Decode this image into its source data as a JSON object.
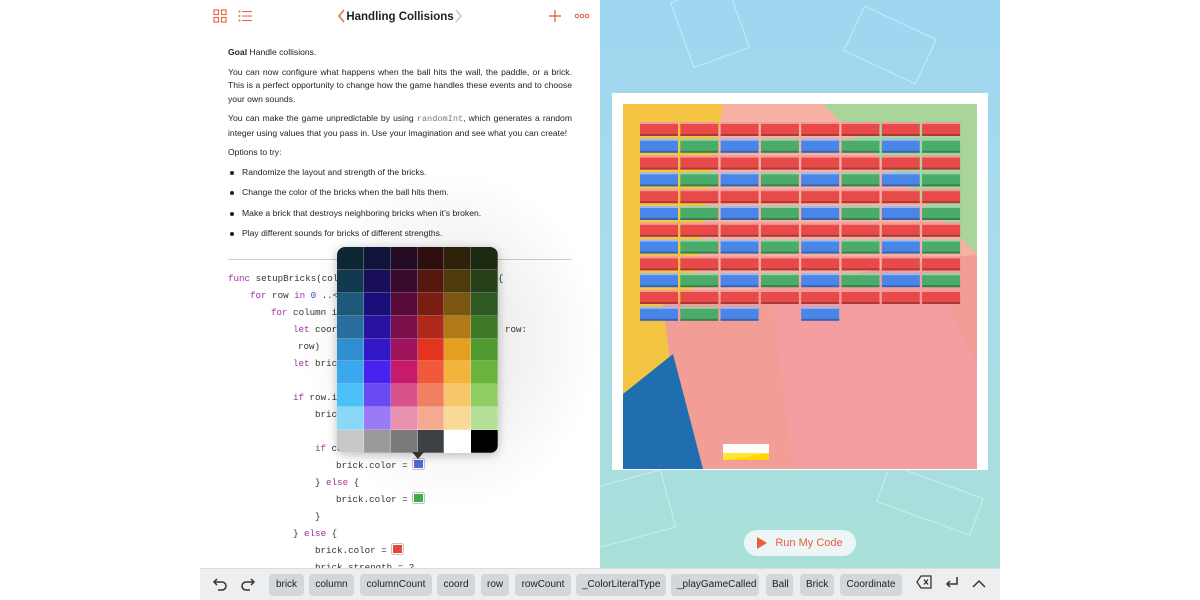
{
  "header": {
    "title": "Handling Collisions",
    "grid_icon": "grid-icon",
    "list_icon": "list-icon",
    "back_icon": "chevron-left-icon",
    "forward_icon": "chevron-right-icon",
    "add_icon": "plus-icon",
    "more_icon": "more-icon"
  },
  "prose": {
    "goal_label": "Goal",
    "goal_text": " Handle collisions.",
    "p1": "You can now configure what happens when the ball hits the wall, the paddle, or a brick. This is a perfect opportunity to change how the game handles these events and to choose your own sounds.",
    "p2_a": "You can make the game unpredictable by using ",
    "p2_code": "randomInt",
    "p2_b": ", which generates a random integer using values that you pass in. Use your imagination and see what you can create!",
    "options_label": "Options to try:",
    "options": [
      "Randomize the layout and strength of the bricks.",
      "Change the color of the bricks when the ball hits them.",
      "Make a brick that destroys neighboring bricks when it’s broken.",
      "Play different sounds for bricks of different strengths."
    ]
  },
  "code": {
    "l1_kw": "func",
    "l1": " setupBricks(col",
    "l1_tail": "{",
    "l2_kw": "for",
    "l2_a": " row ",
    "l2_kw2": "in",
    "l2_num": " 0",
    "l2_b": " ..<",
    "l3_kw": "for",
    "l3_a": " column i",
    "l4_kw": "let",
    "l4_a": " coor",
    "l4_tail": "row:",
    "l5": "row)",
    "l6_kw": "let",
    "l6_a": " bric",
    "l7_kw": "if",
    "l7_a": " row.i",
    "l8": "bric",
    "l9_kw": "if",
    "l9_a": " co",
    "l10": "brick.color = ",
    "l11_a": "} ",
    "l11_kw": "else",
    "l11_b": " {",
    "l12": "brick.color = ",
    "l13": "}",
    "l14_a": "} ",
    "l14_kw": "else",
    "l14_b": " {",
    "l15": "brick.color = ",
    "l16": "brick.strength = 2"
  },
  "swatches": {
    "blue": "#4f6fd8",
    "green": "#3cae4a",
    "red": "#e6463f"
  },
  "palette": {
    "rows": [
      [
        "#0d2633",
        "#10133a",
        "#230b23",
        "#2f0e0e",
        "#2f220a",
        "#1c2a12"
      ],
      [
        "#123a4f",
        "#180e5a",
        "#3a0a2f",
        "#55160e",
        "#4f3a0d",
        "#26401a"
      ],
      [
        "#1d5a7a",
        "#1a0e7a",
        "#5a0a3a",
        "#7a1e12",
        "#7a5612",
        "#2e5a22"
      ],
      [
        "#286f9e",
        "#2a12a0",
        "#7a0f4c",
        "#b0281a",
        "#b07a18",
        "#3e7a28"
      ],
      [
        "#2f8ed0",
        "#3318c8",
        "#a0135c",
        "#e2341f",
        "#e6a020",
        "#4e9a30"
      ],
      [
        "#3aa8ef",
        "#4a22ef",
        "#c81a6a",
        "#f05a3a",
        "#f2b43a",
        "#6ab43e"
      ],
      [
        "#4cc1f7",
        "#6a4af2",
        "#d8538a",
        "#f08060",
        "#f5c66a",
        "#8ecc64"
      ],
      [
        "#8ad8f8",
        "#9a7af5",
        "#e890b0",
        "#f5aa90",
        "#f8da98",
        "#b6e098"
      ],
      [
        "#c8c8c8",
        "#9a9a9a",
        "#7a7a7a",
        "#3d4045",
        "#ffffff",
        "#000000"
      ]
    ]
  },
  "run_button": {
    "label": "Run My Code",
    "icon": "play-icon"
  },
  "bottom_bar": {
    "undo_icon": "undo-icon",
    "redo_icon": "redo-icon",
    "chips": [
      "brick",
      "column",
      "columnCount",
      "coord",
      "row",
      "rowCount",
      "_ColorLiteralType",
      "_playGameCalled",
      "Ball",
      "Brick",
      "Coordinate"
    ],
    "delete_icon": "delete-icon",
    "return_icon": "return-icon",
    "collapse_icon": "chevron-up-icon"
  },
  "game": {
    "brick_rows": [
      [
        "red",
        "red",
        "red",
        "red",
        "red",
        "red",
        "red",
        "red"
      ],
      [
        "blue",
        "green",
        "blue",
        "green",
        "blue",
        "green",
        "blue",
        "green"
      ],
      [
        "red",
        "red",
        "red",
        "red",
        "red",
        "red",
        "red",
        "red"
      ],
      [
        "blue",
        "green",
        "blue",
        "green",
        "blue",
        "green",
        "blue",
        "green"
      ],
      [
        "red",
        "red",
        "red",
        "red",
        "red",
        "red",
        "red",
        "red"
      ],
      [
        "blue",
        "green",
        "blue",
        "green",
        "blue",
        "green",
        "blue",
        "green"
      ],
      [
        "red",
        "red",
        "red",
        "red",
        "red",
        "red",
        "red",
        "red"
      ],
      [
        "blue",
        "green",
        "blue",
        "green",
        "blue",
        "green",
        "blue",
        "green"
      ],
      [
        "red",
        "red",
        "red",
        "red",
        "red",
        "red",
        "red",
        "red"
      ],
      [
        "blue",
        "green",
        "blue",
        "green",
        "blue",
        "green",
        "blue",
        "green"
      ],
      [
        "red",
        "red",
        "red",
        "red",
        "red",
        "red",
        "red",
        "red"
      ],
      [
        "blue",
        "green",
        "blue",
        "",
        "blue",
        "",
        "",
        ""
      ]
    ],
    "colors": {
      "red": "#e84a4a",
      "blue": "#4a86e8",
      "green": "#4aab6a"
    }
  }
}
